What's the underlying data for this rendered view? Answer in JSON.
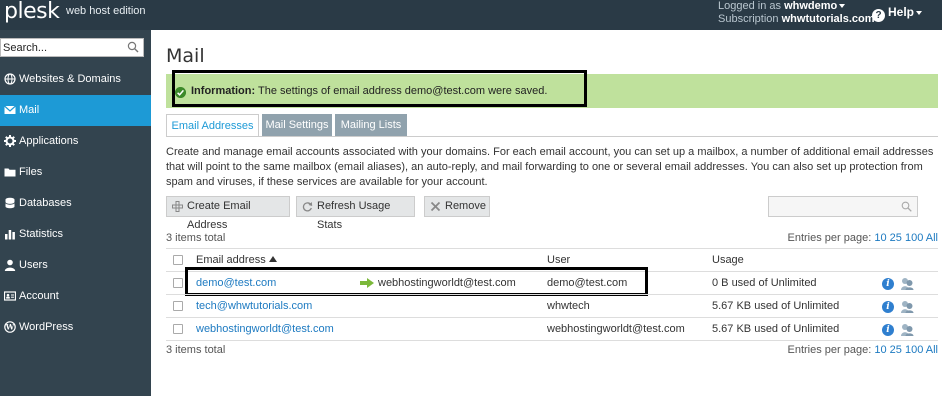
{
  "topbar": {
    "logo": "plesk",
    "edition": "web host edition",
    "logged_in_label": "Logged in as",
    "username": "whwdemo",
    "subscription_label": "Subscription",
    "subscription": "whwtutorials.com",
    "help": "Help"
  },
  "sidebar": {
    "search_placeholder": "Search...",
    "items": [
      {
        "label": "Websites & Domains",
        "icon": "globe-icon"
      },
      {
        "label": "Mail",
        "icon": "envelope-icon",
        "active": true
      },
      {
        "label": "Applications",
        "icon": "gear-icon"
      },
      {
        "label": "Files",
        "icon": "folder-icon"
      },
      {
        "label": "Databases",
        "icon": "database-icon"
      },
      {
        "label": "Statistics",
        "icon": "bar-chart-icon"
      },
      {
        "label": "Users",
        "icon": "user-icon"
      },
      {
        "label": "Account",
        "icon": "id-card-icon"
      },
      {
        "label": "WordPress",
        "icon": "wordpress-icon"
      }
    ]
  },
  "main": {
    "title": "Mail",
    "info": {
      "label": "Information:",
      "message": " The settings of email address demo@test.com were saved."
    },
    "tabs": [
      {
        "label": "Email Addresses",
        "active": true
      },
      {
        "label": "Mail Settings"
      },
      {
        "label": "Mailing Lists"
      }
    ],
    "description": "Create and manage email accounts associated with your domains. For each email account, you can set up a mailbox, a number of additional email addresses that will point to the same mailbox (email aliases), an auto-reply, and mail forwarding to one or several email addresses. You can also set up protection from spam and viruses, if these services are available for your account.",
    "toolbar": {
      "create": "Create Email Address",
      "refresh": "Refresh Usage Stats",
      "remove": "Remove"
    },
    "items_total": "3 items total",
    "entries_label": "Entries per page:",
    "entries_10": "10",
    "entries_25": "25",
    "entries_100": "100",
    "entries_all": "All",
    "columns": {
      "email": "Email address",
      "user": "User",
      "usage": "Usage"
    },
    "rows": [
      {
        "email": "demo@test.com",
        "forward": "webhostingworldt@test.com",
        "user": "demo@test.com",
        "usage": "0 B used of Unlimited"
      },
      {
        "email": "tech@whwtutorials.com",
        "forward": "",
        "user": "whwtech",
        "usage": "5.67 KB used of Unlimited"
      },
      {
        "email": "webhostingworldt@test.com",
        "forward": "",
        "user": "webhostingworldt@test.com",
        "usage": "5.67 KB used of Unlimited"
      }
    ]
  },
  "colors": {
    "topbar": "#2a3a46",
    "sidebar": "#33444f",
    "accent": "#1d9ad6",
    "info_bg": "#bfe19c",
    "link": "#1d7ac1"
  }
}
